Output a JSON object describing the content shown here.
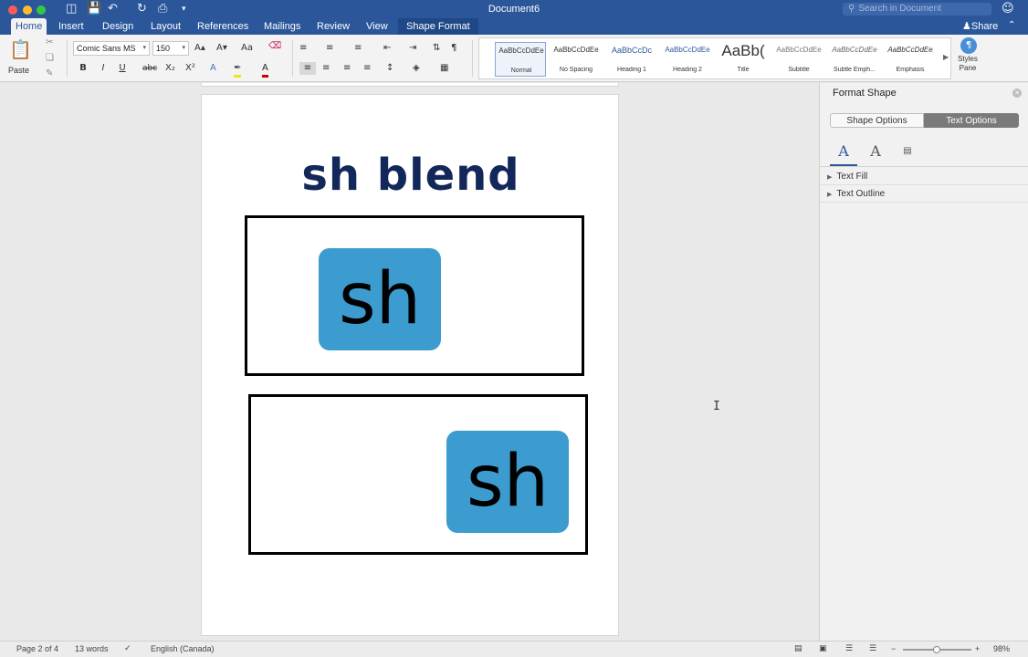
{
  "window": {
    "title": "Document6",
    "search_placeholder": "Search in Document",
    "share_label": "Share"
  },
  "tabs": [
    {
      "label": "Home",
      "active": true
    },
    {
      "label": "Insert"
    },
    {
      "label": "Design"
    },
    {
      "label": "Layout"
    },
    {
      "label": "References"
    },
    {
      "label": "Mailings"
    },
    {
      "label": "Review"
    },
    {
      "label": "View"
    },
    {
      "label": "Shape Format",
      "contextual": true
    }
  ],
  "ribbon": {
    "paste_label": "Paste",
    "font_name": "Comic Sans MS",
    "font_size": "150",
    "bold": "B",
    "italic": "I",
    "underline": "U",
    "strike": "abc",
    "subscript": "X₂",
    "superscript": "X²",
    "styles": [
      {
        "preview": "AaBbCcDdEe",
        "label": "Normal",
        "selected": true
      },
      {
        "preview": "AaBbCcDdEe",
        "label": "No Spacing"
      },
      {
        "preview": "AaBbCcDc",
        "label": "Heading 1"
      },
      {
        "preview": "AaBbCcDdEe",
        "label": "Heading 2"
      },
      {
        "preview": "AaBb(",
        "label": "Title"
      },
      {
        "preview": "AaBbCcDdEe",
        "label": "Subtitle"
      },
      {
        "preview": "AaBbCcDdEe",
        "label": "Subtle Emph..."
      },
      {
        "preview": "AaBbCcDdEe",
        "label": "Emphasis"
      }
    ],
    "styles_pane_label": "Styles Pane"
  },
  "document": {
    "heading": "sh blend",
    "tile_1": "sh",
    "tile_2": "sh",
    "tile_color": "#3d9ccf"
  },
  "format_pane": {
    "title": "Format Shape",
    "tab_shape": "Shape Options",
    "tab_text": "Text Options",
    "sections": [
      "Text Fill",
      "Text Outline"
    ]
  },
  "status": {
    "page": "Page 2 of 4",
    "words": "13 words",
    "language": "English (Canada)",
    "zoom": "98%",
    "zoom_fraction": 0.49
  },
  "colors": {
    "brand": "#2b579a",
    "heading": "#13285a"
  }
}
